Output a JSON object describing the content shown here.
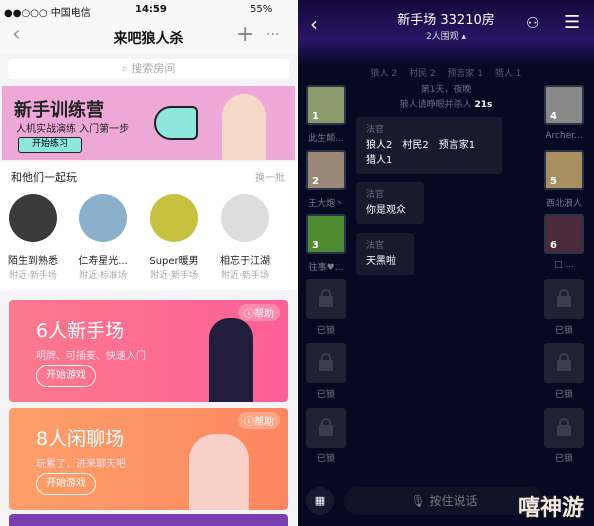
{
  "left": {
    "status": {
      "carrier": "●●○○○ 中国电信",
      "time": "14:59",
      "battery": "55%"
    },
    "nav": {
      "title": "来吧狼人杀",
      "back": "‹",
      "add": "+",
      "more": "···"
    },
    "search_placeholder": "搜索房间",
    "banner": {
      "title": "新手训练营",
      "subtitle": "人机实战演练 入门第一步",
      "button": "开始练习"
    },
    "section": {
      "title": "和他们一起玩",
      "refresh": "换一批",
      "users": [
        {
          "name": "陌生到熟悉",
          "sub": "附近·新手场"
        },
        {
          "name": "仁寿星光...",
          "sub": "附近·标准场"
        },
        {
          "name": "Super暖男",
          "sub": "附近·新手场"
        },
        {
          "name": "相忘于江湖",
          "sub": "附近·新手场"
        }
      ]
    },
    "cards": [
      {
        "title": "6人新手场",
        "subtitle": "明牌、可插麦、快速入门",
        "button": "开始游戏",
        "help": "帮助",
        "color": "#fb6c8f"
      },
      {
        "title": "8人闲聊场",
        "subtitle": "玩累了，进来聊天吧",
        "button": "开始游戏",
        "help": "帮助",
        "color": "#fd8f64"
      }
    ]
  },
  "right": {
    "title": "新手场 33210房",
    "spectators": "2人围观 ▴",
    "roles": "狼人 2　 村民 2　 预言家 1　 猎人 1",
    "phase": "第1天，夜晚",
    "prompt": "狼人请睁眼并杀人",
    "countdown": "21s",
    "left_players": [
      {
        "num": "1",
        "name": "此生颠..."
      },
      {
        "num": "2",
        "name": "王大炮丶"
      },
      {
        "num": "3",
        "name": "往事♥..."
      }
    ],
    "right_players": [
      {
        "num": "4",
        "name": "Archer..."
      },
      {
        "num": "5",
        "name": "西北浪人"
      },
      {
        "num": "6",
        "name": "□ ..."
      }
    ],
    "locked": "已锁",
    "messages": [
      {
        "from": "法官",
        "text": "狼人2　村民2　预言家1",
        "text2": "猎人1"
      },
      {
        "from": "法官",
        "text": "你是观众"
      },
      {
        "from": "法官",
        "text": "天黑啦"
      }
    ],
    "voice_button": "按住说话",
    "watermark": "嘻神游"
  }
}
